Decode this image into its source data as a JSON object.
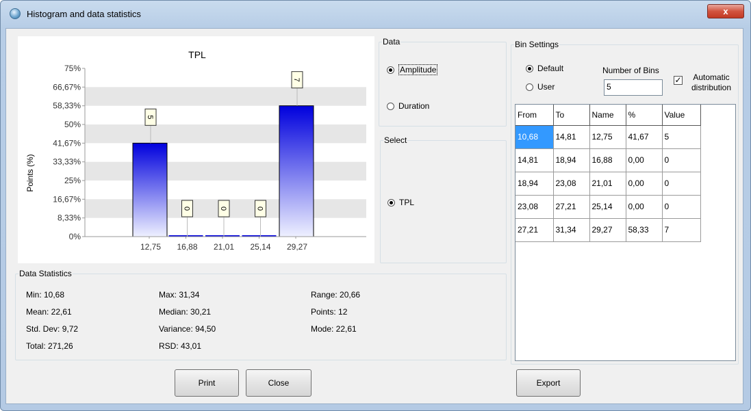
{
  "window": {
    "title": "Histogram and data statistics",
    "close_glyph": "x"
  },
  "chart_data": {
    "type": "bar",
    "title": "TPL",
    "ylabel": "Points (%)",
    "xlabel": "",
    "categories": [
      "12,75",
      "16,88",
      "21,01",
      "25,14",
      "29,27"
    ],
    "values": [
      41.67,
      0,
      0,
      0,
      58.33
    ],
    "data_labels": [
      "5",
      "0",
      "0",
      "0",
      "7"
    ],
    "ylim": [
      0,
      75
    ],
    "yticks": [
      0,
      8.33,
      16.67,
      25,
      33.33,
      41.67,
      50,
      58.33,
      66.67,
      75
    ],
    "ytick_labels": [
      "0%",
      "8,33%",
      "16,67%",
      "25%",
      "33,33%",
      "41,67%",
      "50%",
      "58,33%",
      "66,67%",
      "75%"
    ],
    "grid": "banded",
    "bar_color": "#0000dd"
  },
  "data_group": {
    "legend": "Data",
    "amplitude": "Amplitude",
    "duration": "Duration"
  },
  "select_group": {
    "legend": "Select",
    "tpl": "TPL"
  },
  "bin_settings": {
    "legend": "Bin Settings",
    "default": "Default",
    "user": "User",
    "number_of_bins_label": "Number of Bins",
    "number_of_bins_value": "5",
    "automatic_distribution": "Automatic distribution",
    "columns": [
      "From",
      "To",
      "Name",
      "%",
      "Value"
    ],
    "rows": [
      [
        "10,68",
        "14,81",
        "12,75",
        "41,67",
        "5"
      ],
      [
        "14,81",
        "18,94",
        "16,88",
        "0,00",
        "0"
      ],
      [
        "18,94",
        "23,08",
        "21,01",
        "0,00",
        "0"
      ],
      [
        "23,08",
        "27,21",
        "25,14",
        "0,00",
        "0"
      ],
      [
        "27,21",
        "31,34",
        "29,27",
        "58,33",
        "7"
      ]
    ]
  },
  "statistics": {
    "legend": "Data Statistics",
    "min": "Min: 10,68",
    "max": "Max: 31,34",
    "range": "Range: 20,66",
    "mean": "Mean: 22,61",
    "median": "Median: 30,21",
    "points": "Points: 12",
    "std_dev": "Std. Dev: 9,72",
    "variance": "Variance: 94,50",
    "mode": "Mode: 22,61",
    "total": "Total: 271,26",
    "rsd": "RSD: 43,01"
  },
  "buttons": {
    "print": "Print",
    "close": "Close",
    "export": "Export"
  }
}
